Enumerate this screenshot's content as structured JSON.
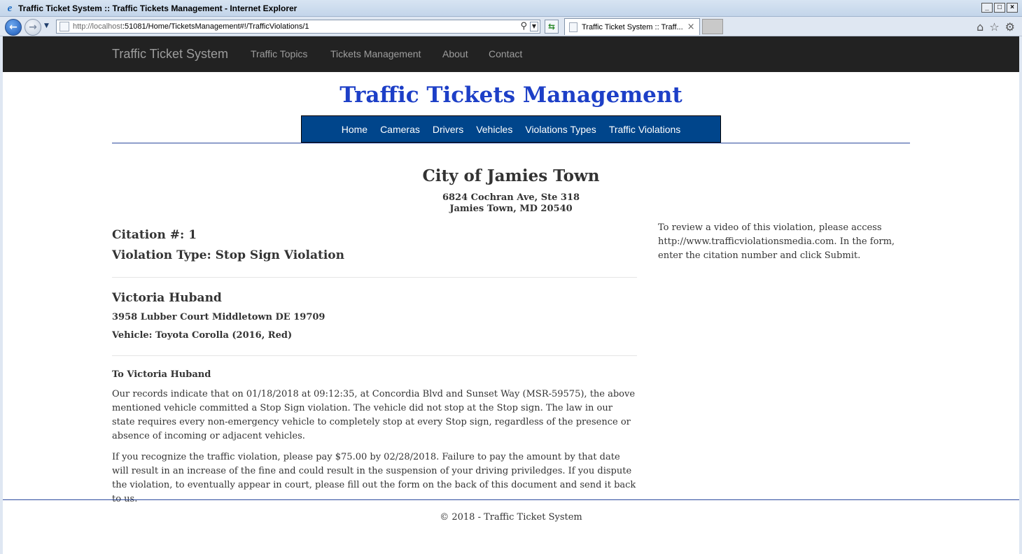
{
  "window": {
    "title": "Traffic Ticket System :: Traffic Tickets Management - Internet Explorer",
    "controls": [
      "_",
      "□",
      "×"
    ]
  },
  "browser": {
    "url_host": "http://localhost",
    "url_path": ":51081/Home/TicketsManagement#!/TrafficViolations/1",
    "tab_title": "Traffic Ticket System :: Traff...",
    "tab_close": "×",
    "icons": [
      "home-icon",
      "star-icon",
      "gear-icon"
    ]
  },
  "navbar": {
    "brand": "Traffic Ticket System",
    "links": [
      "Traffic Topics",
      "Tickets Management",
      "About",
      "Contact"
    ]
  },
  "header": {
    "title": "Traffic Tickets Management",
    "subnav": [
      "Home",
      "Cameras",
      "Drivers",
      "Vehicles",
      "Violations Types",
      "Traffic Violations"
    ]
  },
  "city": {
    "name": "City of Jamies Town",
    "address_line1": "6824 Cochran Ave, Ste 318",
    "address_line2": "Jamies Town, MD 20540"
  },
  "citation": {
    "number_label": "Citation #: 1",
    "violation_type": "Violation Type: Stop Sign Violation"
  },
  "driver": {
    "name": "Victoria Huband",
    "address": "3958 Lubber Court Middletown DE 19709",
    "vehicle": "Vehicle: Toyota Corolla (2016, Red)"
  },
  "letter": {
    "to": "To Victoria Huband",
    "paragraph1": "Our records indicate that on 01/18/2018 at 09:12:35, at Concordia Blvd and Sunset Way (MSR-59575), the above mentioned vehicle committed a Stop Sign violation. The vehicle did not stop at the Stop sign. The law in our state requires every non-emergency vehicle to completely stop at every Stop sign, regardless of the presence or absence of incoming or adjacent vehicles.",
    "paragraph2": "If you recognize the traffic violation, please pay $75.00 by 02/28/2018. Failure to pay the amount by that date will result in an increase of the fine and could result in the suspension of your driving priviledges. If you dispute the violation, to eventually appear in court, please fill out the form on the back of this document and send it back to us."
  },
  "side_note": "To review a video of this violation, please access http://www.trafficviolationsmedia.com. In the form, enter the citation number and click Submit.",
  "footer": "© 2018 - Traffic Ticket System",
  "colors": {
    "heading_blue": "#1d3fc7",
    "subnav_bg": "#00458b",
    "navbar_bg": "#222222"
  }
}
